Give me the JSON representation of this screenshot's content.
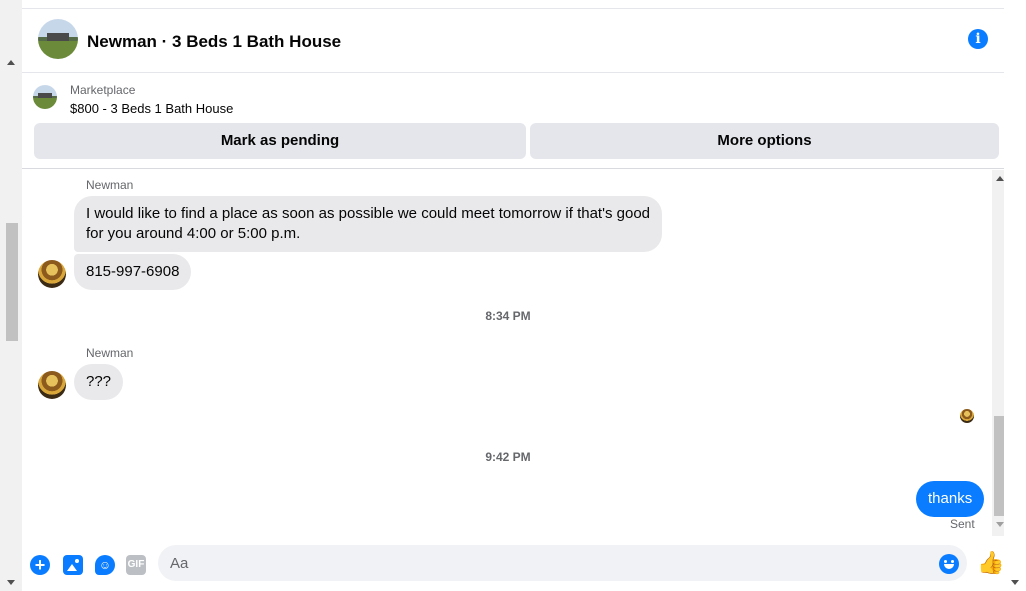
{
  "header": {
    "title": "Newman · 3 Beds 1 Bath House",
    "info_icon": "info-icon"
  },
  "marketplace": {
    "label": "Marketplace",
    "item": "$800 - 3 Beds 1 Bath House",
    "mark_pending_label": "Mark as pending",
    "more_options_label": "More options"
  },
  "messages": [
    {
      "sender": "Newman"
    },
    {
      "text": "I would like to find a place as soon as possible we could meet tomorrow if that's good for you around 4:00 or 5:00 p.m."
    },
    {
      "text": "815-997-6908"
    },
    {
      "timestamp": "8:34 PM"
    },
    {
      "sender": "Newman",
      "text": "???"
    },
    {
      "timestamp": "9:42 PM"
    },
    {
      "text": "thanks",
      "status": "Sent"
    }
  ],
  "composer": {
    "placeholder": "Aa",
    "gif_label": "GIF"
  },
  "colors": {
    "accent": "#0a7cff",
    "incoming_bubble": "#e9e9eb",
    "button_bg": "#e4e6eb",
    "muted_text": "#65676b"
  }
}
